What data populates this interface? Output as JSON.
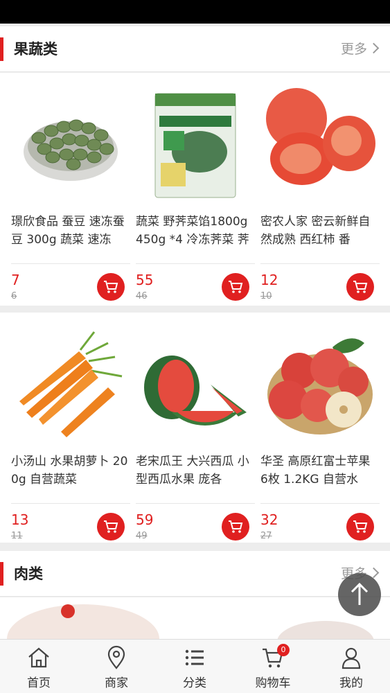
{
  "sections": {
    "fruits_veg": {
      "title": "果蔬类",
      "more": "更多"
    },
    "meat": {
      "title": "肉类",
      "more": "更多"
    }
  },
  "products": [
    {
      "name": "璟欣食品 蚕豆 速冻蚕豆 300g 蔬菜 速冻",
      "price": "7",
      "old_price": "6",
      "icon": "broad-beans-image"
    },
    {
      "name": "蔬菜 野荠菜馅1800g 450g *4 冷冻荠菜 荠",
      "price": "55",
      "old_price": "46",
      "icon": "shepherds-purse-pack-image"
    },
    {
      "name": "密农人家 密云新鲜自然成熟 西红柿 番",
      "price": "12",
      "old_price": "10",
      "icon": "tomato-image"
    },
    {
      "name": "小汤山 水果胡萝卜 200g 自营蔬菜",
      "price": "13",
      "old_price": "11",
      "icon": "carrot-image"
    },
    {
      "name": "老宋瓜王 大兴西瓜 小型西瓜水果 庞各",
      "price": "59",
      "old_price": "49",
      "icon": "watermelon-image"
    },
    {
      "name": "华圣 高原红富士苹果 6枚 1.2KG 自营水",
      "price": "32",
      "old_price": "27",
      "icon": "apple-image"
    }
  ],
  "tabbar": {
    "home": "首页",
    "merchant": "商家",
    "category": "分类",
    "cart": "购物车",
    "mine": "我的",
    "cart_badge": "0"
  },
  "colors": {
    "accent": "#e02020",
    "background": "#ededed"
  }
}
